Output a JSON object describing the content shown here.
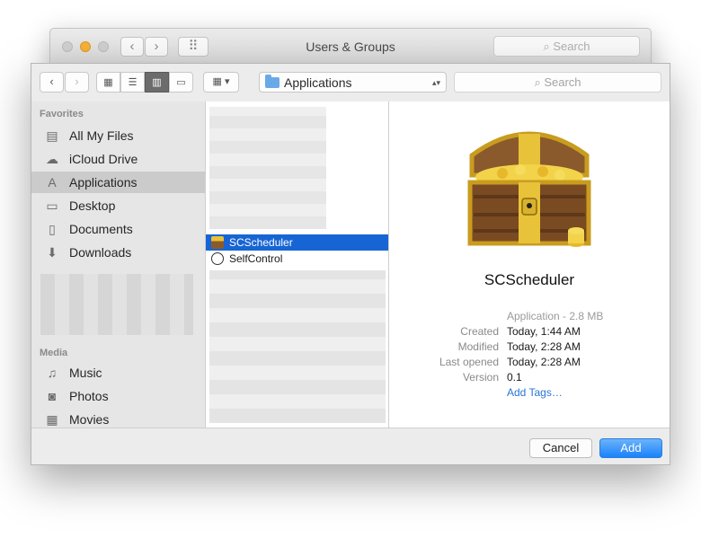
{
  "background_window": {
    "title": "Users & Groups",
    "search_placeholder": "Search",
    "nav_back": "‹",
    "nav_forward": "›",
    "grid_icon": "⠿"
  },
  "toolbar": {
    "back": "‹",
    "forward": "›",
    "view_icons": "▦",
    "view_list": "☰",
    "view_columns": "▥",
    "view_coverflow": "▭",
    "arrange": "▦ ▾",
    "location": "Applications",
    "location_arrows": "▴▾",
    "search_placeholder": "Search"
  },
  "sidebar": {
    "favorites_header": "Favorites",
    "favorites": [
      {
        "label": "All My Files",
        "icon": "▤"
      },
      {
        "label": "iCloud Drive",
        "icon": "☁"
      },
      {
        "label": "Applications",
        "icon": "A"
      },
      {
        "label": "Desktop",
        "icon": "▭"
      },
      {
        "label": "Documents",
        "icon": "▯"
      },
      {
        "label": "Downloads",
        "icon": "⬇"
      }
    ],
    "media_header": "Media",
    "media": [
      {
        "label": "Music",
        "icon": "♫"
      },
      {
        "label": "Photos",
        "icon": "◙"
      },
      {
        "label": "Movies",
        "icon": "▦"
      }
    ]
  },
  "column": {
    "rows": [
      {
        "label": "SCScheduler",
        "selected": true,
        "icon": "chest"
      },
      {
        "label": "SelfControl",
        "selected": false,
        "icon": "selfcontrol"
      }
    ]
  },
  "preview": {
    "name": "SCScheduler",
    "kind": "Application - 2.8 MB",
    "fields": [
      {
        "key": "Created",
        "value": "Today, 1:44 AM"
      },
      {
        "key": "Modified",
        "value": "Today, 2:28 AM"
      },
      {
        "key": "Last opened",
        "value": "Today, 2:28 AM"
      },
      {
        "key": "Version",
        "value": "0.1"
      }
    ],
    "add_tags": "Add Tags…"
  },
  "buttons": {
    "cancel": "Cancel",
    "add": "Add"
  }
}
